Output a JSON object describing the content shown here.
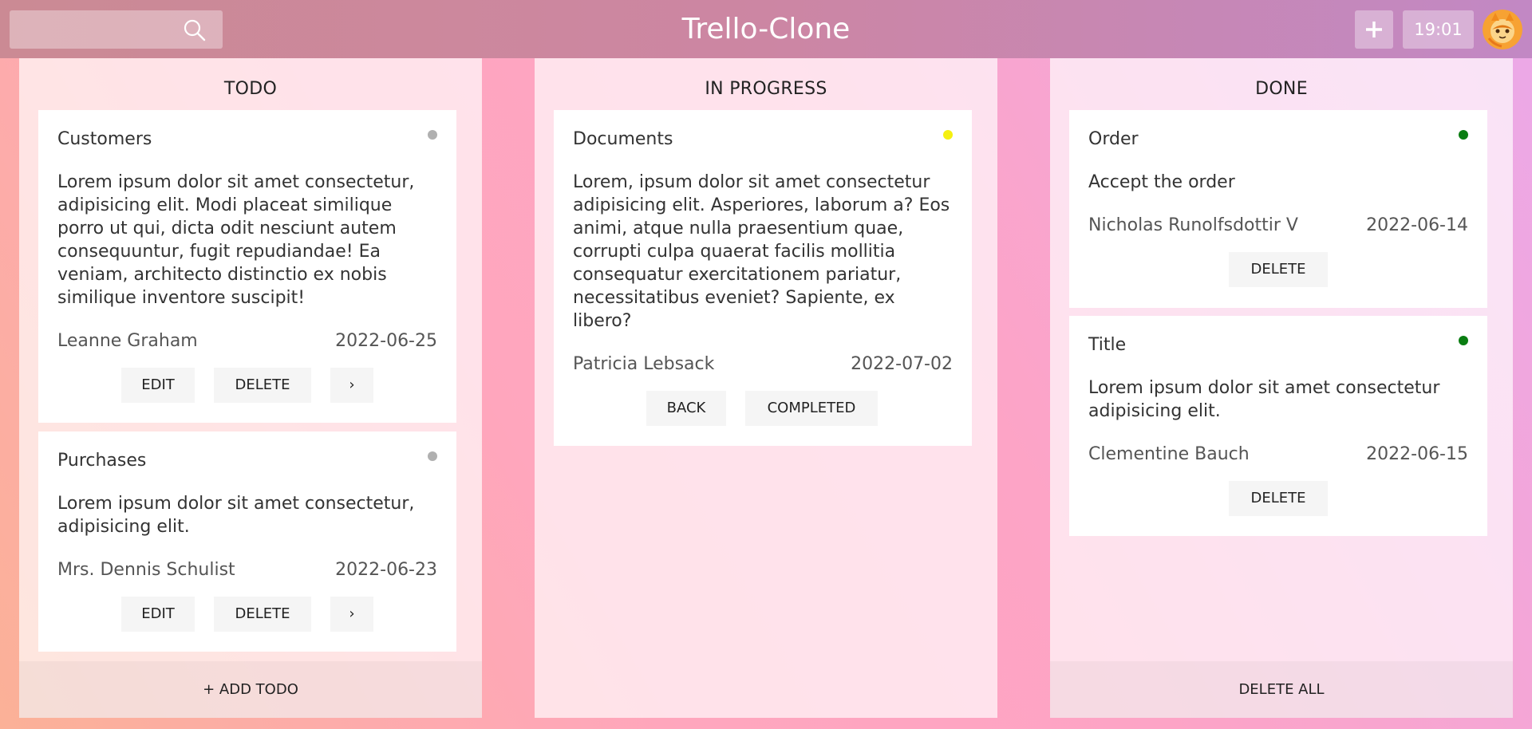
{
  "header": {
    "title": "Trello-Clone",
    "search": {
      "placeholder": "",
      "icon": "search-icon"
    },
    "add_label": "+",
    "time": "19:01"
  },
  "columns": [
    {
      "title": "TODO",
      "footer": "+ ADD TODO",
      "cards": [
        {
          "title": "Customers",
          "status_color": "#b0b0b0",
          "description": "Lorem ipsum dolor sit amet consectetur, adipisicing elit. Modi placeat similique porro ut qui, dicta odit nesciunt autem consequuntur, fugit repudiandae! Ea veniam, architecto distinctio ex nobis similique inventore suscipit!",
          "author": "Leanne Graham",
          "date": "2022-06-25",
          "buttons": [
            "EDIT",
            "DELETE",
            "›"
          ]
        },
        {
          "title": "Purchases",
          "status_color": "#b0b0b0",
          "description": "Lorem ipsum dolor sit amet consectetur, adipisicing elit.",
          "author": "Mrs. Dennis Schulist",
          "date": "2022-06-23",
          "buttons": [
            "EDIT",
            "DELETE",
            "›"
          ]
        }
      ]
    },
    {
      "title": "IN PROGRESS",
      "cards": [
        {
          "title": "Documents",
          "status_color": "#f5f010",
          "description": "Lorem, ipsum dolor sit amet consectetur adipisicing elit. Asperiores, laborum a? Eos animi, atque nulla praesentium quae, corrupti culpa quaerat facilis mollitia consequatur exercitationem pariatur, necessitatibus eveniet? Sapiente, ex libero?",
          "author": "Patricia Lebsack",
          "date": "2022-07-02",
          "buttons": [
            "BACK",
            "COMPLETED"
          ]
        }
      ]
    },
    {
      "title": "DONE",
      "footer": "DELETE ALL",
      "cards": [
        {
          "title": "Order",
          "status_color": "#0a7d12",
          "description": "Accept the order",
          "author": "Nicholas Runolfsdottir V",
          "date": "2022-06-14",
          "buttons": [
            "DELETE"
          ]
        },
        {
          "title": "Title",
          "status_color": "#0a7d12",
          "description": "Lorem ipsum dolor sit amet consectetur adipisicing elit.",
          "author": "Clementine Bauch",
          "date": "2022-06-15",
          "buttons": [
            "DELETE"
          ]
        }
      ]
    }
  ]
}
